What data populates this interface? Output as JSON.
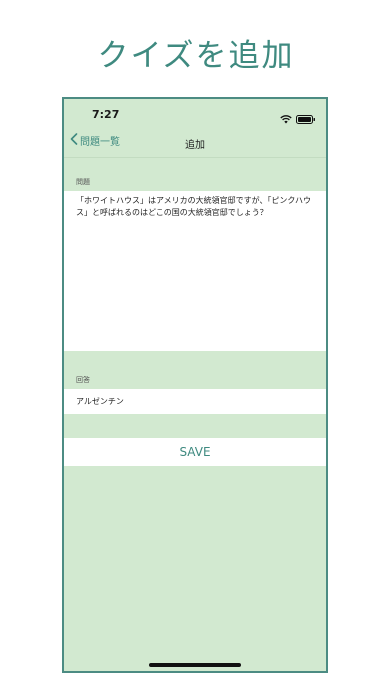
{
  "promo": {
    "title": "クイズを追加"
  },
  "status_bar": {
    "time": "7:27",
    "icons": [
      "wifi-icon",
      "battery-icon"
    ]
  },
  "nav": {
    "back_label": "問題一覧",
    "title": "追加"
  },
  "form": {
    "question_label": "問題",
    "question_value": "「ホワイトハウス」はアメリカの大統領官邸ですが、「ピンクハウス」と呼ばれるのはどこの国の大統領官邸でしょう？",
    "answer_label": "回答",
    "answer_value": "アルゼンチン",
    "save_label": "SAVE"
  },
  "colors": {
    "accent": "#3f8a80",
    "background": "#d2e9d0",
    "frame": "#4c8c83"
  }
}
